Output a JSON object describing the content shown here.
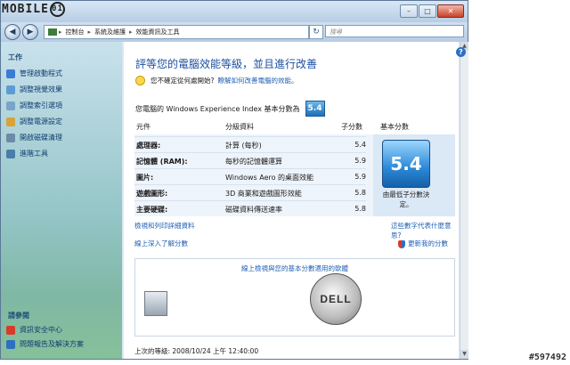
{
  "watermark": {
    "brand": "MOBILE",
    "brand_num": "01",
    "id": "#597492"
  },
  "window": {
    "btn_min": "–",
    "btn_max": "□",
    "btn_close": "✕"
  },
  "nav": {
    "back": "◀",
    "forward": "▶",
    "breadcrumb": [
      "控制台",
      "系統及維護",
      "效能資訊及工具"
    ],
    "refresh": "↻",
    "search_placeholder": "搜尋"
  },
  "sidebar": {
    "tasks_title": "工作",
    "tasks": [
      {
        "label": "管理啟動程式",
        "color": "#3a7bd5"
      },
      {
        "label": "調整視覺效果",
        "color": "#5c9bd6"
      },
      {
        "label": "調整索引選項",
        "color": "#7ba4c9"
      },
      {
        "label": "調整電源設定",
        "color": "#d9a23a"
      },
      {
        "label": "開啟磁碟清理",
        "color": "#6c8aa6"
      },
      {
        "label": "進階工具",
        "color": "#4a7ea8"
      }
    ],
    "see_also_title": "請參閱",
    "see_also": [
      {
        "label": "資訊安全中心",
        "color": "#d83b2a"
      },
      {
        "label": "問題報告及解決方案",
        "color": "#2f6fc2"
      }
    ]
  },
  "main": {
    "heading": "評等您的電腦效能等級，並且進行改善",
    "tip_text": "您不確定從何處開始?",
    "tip_link": "瞭解如何改善電腦的效能。",
    "score_text": "您電腦的 Windows Experience Index 基本分數為",
    "score_badge": "5.4",
    "table_headers": {
      "component": "元件",
      "rated": "分級資料",
      "subscore": "子分數",
      "basescore": "基本分數"
    },
    "rows": [
      {
        "component": "處理器:",
        "rated": "計算 (每秒)",
        "subscore": "5.4"
      },
      {
        "component": "記憶體 (RAM):",
        "rated": "每秒的記憶體運算",
        "subscore": "5.9"
      },
      {
        "component": "圖片:",
        "rated": "Windows Aero 的桌面效能",
        "subscore": "5.9"
      },
      {
        "component": "遊戲圖形:",
        "rated": "3D 商業和遊戲圖形效能",
        "subscore": "5.8"
      },
      {
        "component": "主要硬碟:",
        "rated": "磁碟資料傳送速率",
        "subscore": "5.8"
      }
    ],
    "big_score": "5.4",
    "big_caption": "由最低子分數決定。",
    "link_details": "檢視和列印詳細資料",
    "link_meaning": "這些數字代表什麼意思?",
    "link_learn": "線上深入了解分數",
    "link_update": "更新我的分數",
    "panel_title": "線上檢視與您的基本分數適用的軟體",
    "dell_logo": "DELL",
    "last_rated": "上次的等級: 2008/10/24 上午 12:40:00"
  }
}
